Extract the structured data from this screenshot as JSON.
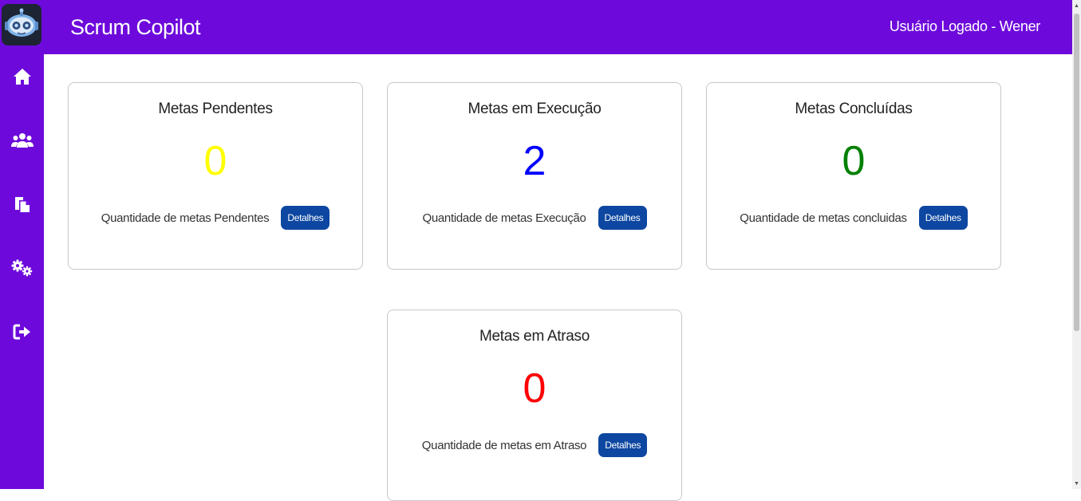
{
  "header": {
    "app_title": "Scrum Copilot",
    "user_label": "Usuário Logado - Wener"
  },
  "sidebar": {
    "items": [
      {
        "name": "home",
        "icon": "home-icon"
      },
      {
        "name": "users",
        "icon": "users-icon"
      },
      {
        "name": "clipboard",
        "icon": "clipboard-icon"
      },
      {
        "name": "settings",
        "icon": "gears-icon"
      },
      {
        "name": "logout",
        "icon": "sign-out-icon"
      }
    ]
  },
  "cards": [
    {
      "title": "Metas Pendentes",
      "count": "0",
      "count_color": "#ffff00",
      "description": "Quantidade de metas Pendentes",
      "button_label": "Detalhes"
    },
    {
      "title": "Metas em Execução",
      "count": "2",
      "count_color": "#0000ff",
      "description": "Quantidade de metas Execução",
      "button_label": "Detalhes"
    },
    {
      "title": "Metas Concluídas",
      "count": "0",
      "count_color": "#008000",
      "description": "Quantidade de metas concluidas",
      "button_label": "Detalhes"
    },
    {
      "title": "Metas em Atraso",
      "count": "0",
      "count_color": "#ff0000",
      "description": "Quantidade de metas em Atraso",
      "button_label": "Detalhes"
    }
  ],
  "colors": {
    "primary": "#6d0adb",
    "button": "#0d47a1"
  }
}
